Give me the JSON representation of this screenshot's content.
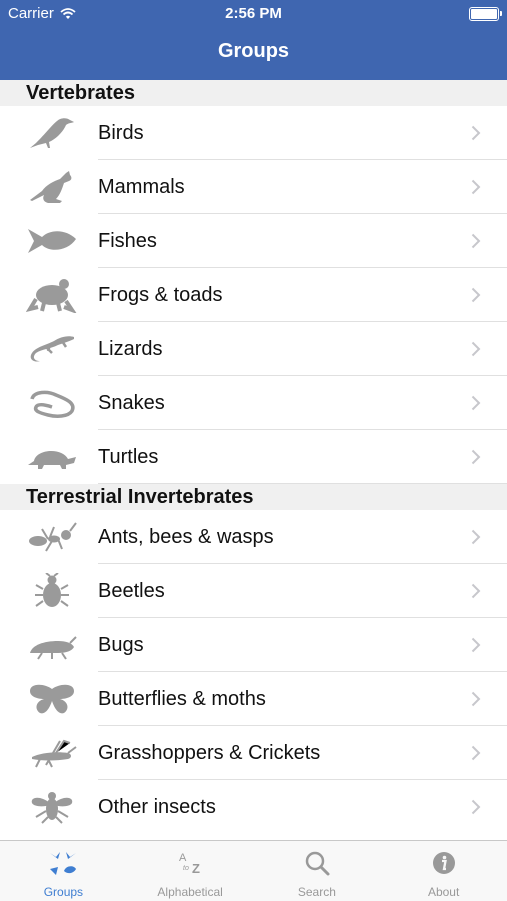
{
  "status_bar": {
    "carrier": "Carrier",
    "time": "2:56 PM"
  },
  "nav": {
    "title": "Groups"
  },
  "sections": [
    {
      "title": "Vertebrates",
      "items": [
        {
          "label": "Birds",
          "icon": "bird-icon"
        },
        {
          "label": "Mammals",
          "icon": "kangaroo-icon"
        },
        {
          "label": "Fishes",
          "icon": "fish-icon"
        },
        {
          "label": "Frogs & toads",
          "icon": "frog-icon"
        },
        {
          "label": "Lizards",
          "icon": "lizard-icon"
        },
        {
          "label": "Snakes",
          "icon": "snake-icon"
        },
        {
          "label": "Turtles",
          "icon": "turtle-icon"
        }
      ]
    },
    {
      "title": "Terrestrial Invertebrates",
      "items": [
        {
          "label": "Ants, bees & wasps",
          "icon": "ant-icon"
        },
        {
          "label": "Beetles",
          "icon": "beetle-icon"
        },
        {
          "label": "Bugs",
          "icon": "bug-icon"
        },
        {
          "label": "Butterflies & moths",
          "icon": "butterfly-icon"
        },
        {
          "label": "Grasshoppers & Crickets",
          "icon": "grasshopper-icon"
        },
        {
          "label": "Other insects",
          "icon": "insect-icon"
        }
      ]
    }
  ],
  "tabs": [
    {
      "label": "Groups",
      "icon": "groups-icon",
      "active": true
    },
    {
      "label": "Alphabetical",
      "icon": "a-to-z-icon",
      "active": false
    },
    {
      "label": "Search",
      "icon": "search-icon",
      "active": false
    },
    {
      "label": "About",
      "icon": "info-icon",
      "active": false
    }
  ],
  "colors": {
    "nav_bar": "#3f66b0",
    "active_tab": "#3f7ed1",
    "inactive_tab": "#999999",
    "icon_gray": "#9a9a9a"
  }
}
